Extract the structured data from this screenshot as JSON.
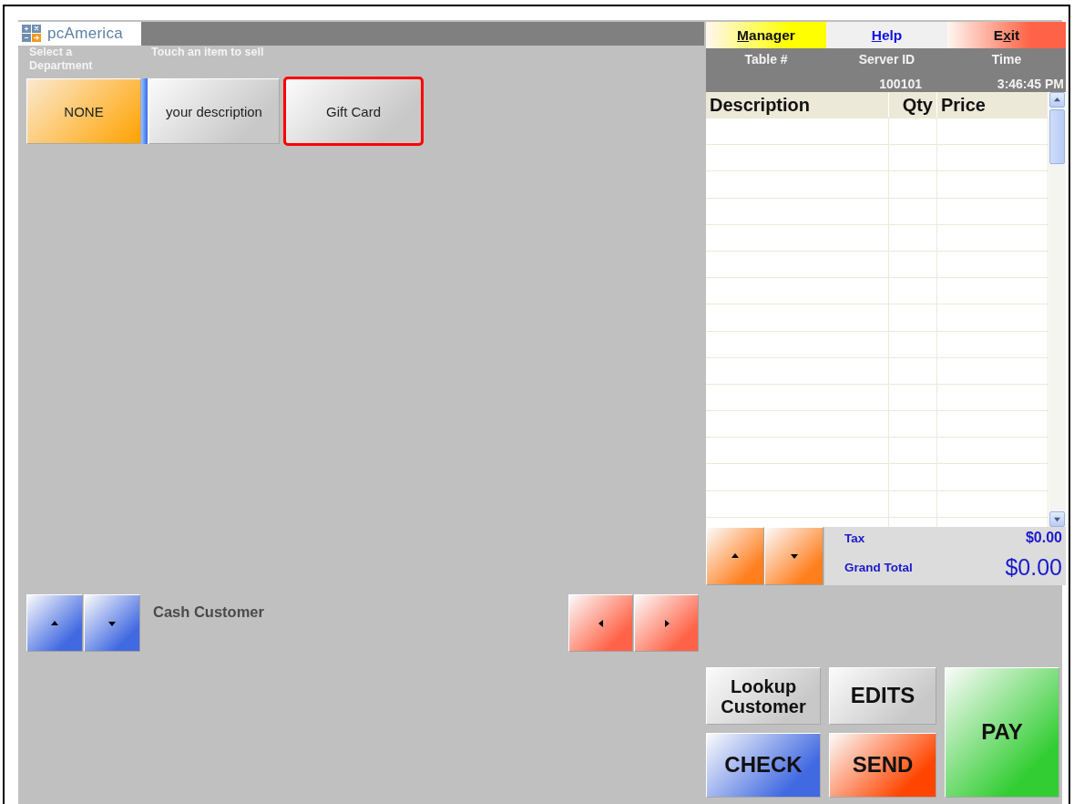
{
  "logo": {
    "text": "pcAmerica"
  },
  "labels": {
    "departments": "Select a Department",
    "items": "Touch an item to sell"
  },
  "departments": [
    {
      "label": "NONE",
      "selected": true
    }
  ],
  "items": [
    {
      "label": "your description",
      "selected": false
    },
    {
      "label": "Gift Card",
      "selected": true
    }
  ],
  "customer": {
    "name": "Cash Customer"
  },
  "customer_nav": [
    {
      "kind": "up",
      "color": "#4169e1"
    },
    {
      "kind": "down",
      "color": "#4169e1"
    }
  ],
  "item_nav": [
    {
      "kind": "left",
      "color": "#ff6347"
    },
    {
      "kind": "right",
      "color": "#ff6347"
    }
  ],
  "menu": [
    {
      "key": "M",
      "post": "anager",
      "color": "#ffff00"
    },
    {
      "key": "H",
      "post": "elp",
      "color": "#f0f0f0"
    },
    {
      "pre": "E",
      "key": "x",
      "post": "it",
      "color": "#ff6347"
    }
  ],
  "info": [
    {
      "label": "Table #"
    },
    {
      "label": "Server ID",
      "value": "100101"
    },
    {
      "label": "Time",
      "value": "3:46:45 PM"
    }
  ],
  "table": {
    "columns": [
      "Description",
      "Qty",
      "Price"
    ]
  },
  "order_nav": [
    {
      "kind": "up",
      "color": "#ff7f1e"
    },
    {
      "kind": "down",
      "color": "#ff7f1e"
    }
  ],
  "totals": [
    {
      "label": "Tax",
      "value": "$0.00",
      "kind": "small"
    },
    {
      "label": "Grand Total",
      "value": "$0.00",
      "kind": "large"
    }
  ],
  "actions": [
    {
      "label": "Lookup Customer",
      "color": "#c8c8c8"
    },
    {
      "label": "EDITS",
      "color": "#c8c8c8"
    },
    {
      "label": "PAY",
      "color": "#32cd32",
      "kind": "tall"
    },
    {
      "label": "CHECK",
      "color": "#4169e1"
    },
    {
      "label": "SEND",
      "color": "#ff4500"
    }
  ]
}
